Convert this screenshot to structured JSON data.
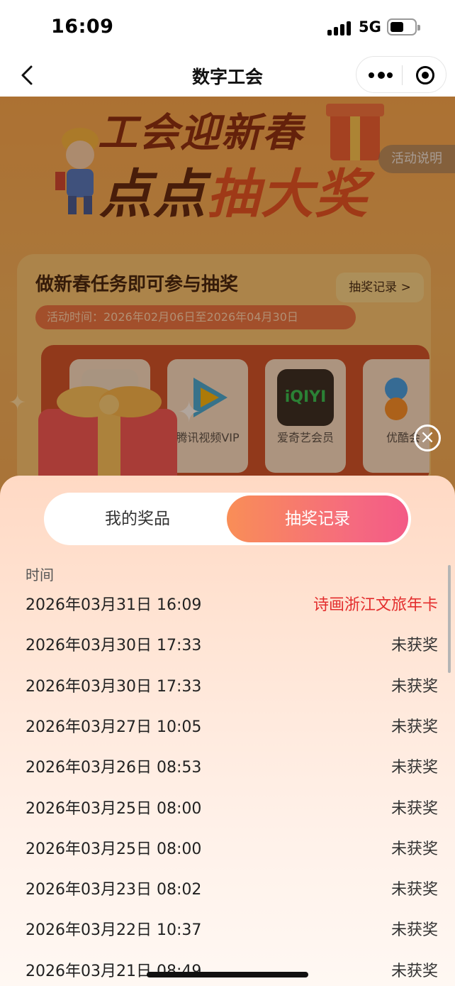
{
  "status_bar": {
    "time": "16:09",
    "network": "5G"
  },
  "nav": {
    "title": "数字工会"
  },
  "background_page": {
    "hero_line1": "工会迎新春",
    "hero_line2a": "点点",
    "hero_line2b": "抽大奖",
    "rules_label": "活动说明",
    "task_title": "做新春任务即可参与抽奖",
    "record_link": "抽奖记录 >",
    "activity_time": "活动时间：2026年02月06日至2026年04月30日",
    "prizes": [
      {
        "label": "",
        "logo_color": "#f0e4d4"
      },
      {
        "label": "腾讯视频VIP",
        "logo_color": "#2ea7e0"
      },
      {
        "label": "爱奇艺会员",
        "logo_color": "#19a642"
      },
      {
        "label": "优酷会",
        "logo_color": "#2b9bf2"
      }
    ]
  },
  "sheet": {
    "tabs": {
      "my_prizes": "我的奖品",
      "draw_records": "抽奖记录"
    },
    "column_header": "时间",
    "records": [
      {
        "time": "2026年03月31日 16:09",
        "result": "诗画浙江文旅年卡",
        "won": true
      },
      {
        "time": "2026年03月30日 17:33",
        "result": "未获奖",
        "won": false
      },
      {
        "time": "2026年03月30日 17:33",
        "result": "未获奖",
        "won": false
      },
      {
        "time": "2026年03月27日 10:05",
        "result": "未获奖",
        "won": false
      },
      {
        "time": "2026年03月26日 08:53",
        "result": "未获奖",
        "won": false
      },
      {
        "time": "2026年03月25日 08:00",
        "result": "未获奖",
        "won": false
      },
      {
        "time": "2026年03月25日 08:00",
        "result": "未获奖",
        "won": false
      },
      {
        "time": "2026年03月23日 08:02",
        "result": "未获奖",
        "won": false
      },
      {
        "time": "2026年03月22日 10:37",
        "result": "未获奖",
        "won": false
      },
      {
        "time": "2026年03月21日 08:49",
        "result": "未获奖",
        "won": false
      }
    ]
  },
  "colors": {
    "accent_gradient_start": "#f98e57",
    "accent_gradient_end": "#f35a86",
    "won_text": "#e32d2d"
  }
}
